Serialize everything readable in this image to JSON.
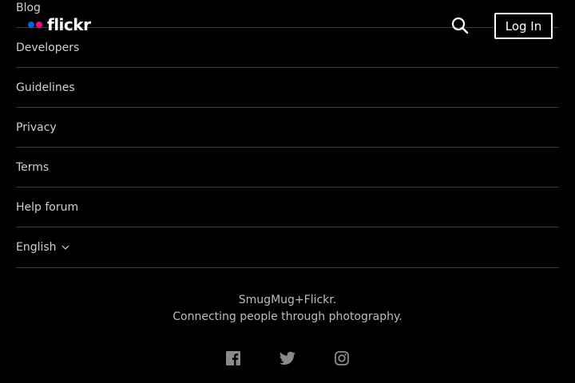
{
  "header": {
    "logo_text": "flickr",
    "logo_dot_colors": [
      "#0063dc",
      "#ff0084"
    ],
    "login_label": "Log In"
  },
  "footer": {
    "links": [
      {
        "label": "Blog"
      },
      {
        "label": "Developers"
      },
      {
        "label": "Guidelines"
      },
      {
        "label": "Privacy"
      },
      {
        "label": "Terms"
      },
      {
        "label": "Help forum"
      }
    ],
    "language": "English",
    "tagline_line1": "SmugMug+Flickr.",
    "tagline_line2": "Connecting people through photography.",
    "social": [
      "facebook-icon",
      "twitter-icon",
      "instagram-icon"
    ]
  },
  "colors": {
    "background": "#000000",
    "text": "#d0d0d0",
    "divider": "#3a3a3a",
    "social_icon": "#8a8a8a"
  }
}
